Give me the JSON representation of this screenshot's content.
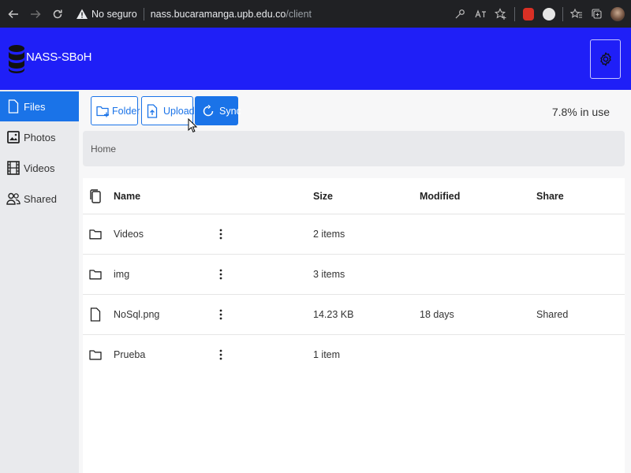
{
  "browser": {
    "back_icon": "back-arrow-icon",
    "forward_icon": "forward-arrow-icon",
    "reload_icon": "reload-icon",
    "security_label": "No seguro",
    "url_host": "nass.bucaramanga.upb.edu.co",
    "url_path": "/client"
  },
  "app": {
    "title": "NASS-SBoH",
    "brand_color": "#1f1ff7",
    "accent_color": "#1a73e8"
  },
  "sidebar": {
    "items": [
      {
        "label": "Files",
        "icon": "file-icon",
        "active": true
      },
      {
        "label": "Photos",
        "icon": "photo-icon",
        "active": false
      },
      {
        "label": "Videos",
        "icon": "film-icon",
        "active": false
      },
      {
        "label": "Shared",
        "icon": "users-icon",
        "active": false
      }
    ]
  },
  "toolbar": {
    "folder_label": "Folder",
    "upload_label": "Upload",
    "sync_label": "Sync",
    "usage": "7.8% in use"
  },
  "breadcrumb": {
    "home": "Home"
  },
  "table": {
    "headers": {
      "name": "Name",
      "size": "Size",
      "modified": "Modified",
      "share": "Share"
    },
    "rows": [
      {
        "type": "folder",
        "name": "Videos",
        "size": "2 items",
        "modified": "",
        "share": ""
      },
      {
        "type": "folder",
        "name": "img",
        "size": "3 items",
        "modified": "",
        "share": ""
      },
      {
        "type": "file",
        "name": "NoSql.png",
        "size": "14.23 KB",
        "modified": "18 days",
        "share": "Shared"
      },
      {
        "type": "folder",
        "name": "Prueba",
        "size": "1 item",
        "modified": "",
        "share": ""
      }
    ]
  }
}
